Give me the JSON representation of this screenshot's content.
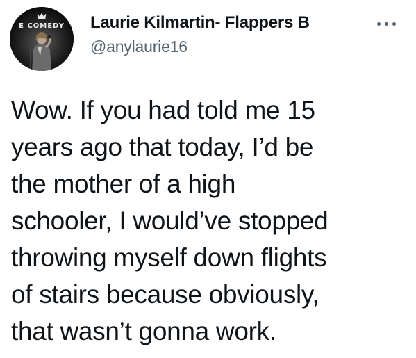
{
  "tweet": {
    "author": {
      "display_name": "Laurie Kilmartin- Flappers B",
      "handle": "@anylaurie16",
      "avatar_banner_text": "E COMEDY"
    },
    "text": "Wow. If you had told me 15\nyears ago that today, I’d be\nthe mother of a high\nschooler, I would’ve stopped\nthrowing myself down flights\nof stairs because obviously,\nthat wasn’t gonna work."
  },
  "colors": {
    "text_primary": "#0f1419",
    "text_secondary": "#536471",
    "background": "#ffffff"
  },
  "icons": {
    "more": "more-horizontal-icon"
  }
}
